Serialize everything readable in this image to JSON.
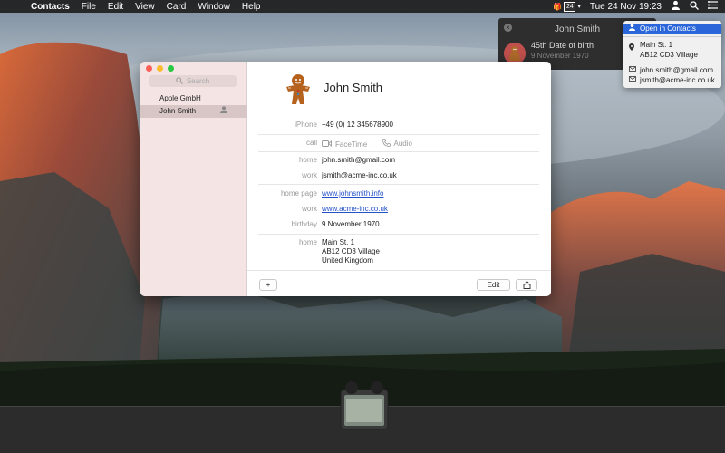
{
  "menubar": {
    "app_name": "Contacts",
    "menus": [
      "File",
      "Edit",
      "View",
      "Card",
      "Window",
      "Help"
    ],
    "calendar_icon_text": "24",
    "clock": "Tue 24 Nov  19:23"
  },
  "birthday_popup": {
    "name": "John Smith",
    "title": "45th Date of birth",
    "date": "9 November 1970"
  },
  "dropdown": {
    "open_label": "Open in Contacts",
    "address_line1": "Main St. 1",
    "address_line2": "AB12 CD3 Village",
    "email1": "john.smith@gmail.com",
    "email2": "jsmith@acme-inc.co.uk"
  },
  "sidebar": {
    "search_placeholder": "Search",
    "items": [
      "Apple GmbH",
      "John Smith"
    ],
    "selected_index": 1
  },
  "card": {
    "name": "John Smith",
    "phone_label": "iPhone",
    "phone": "+49 (0) 12 345678900",
    "call_label": "call",
    "facetime_label": "FaceTime",
    "audio_label": "Audio",
    "email_home_label": "home",
    "email_home": "john.smith@gmail.com",
    "email_work_label": "work",
    "email_work": "jsmith@acme-inc.co.uk",
    "homepage_label": "home page",
    "homepage": "www.johnsmith.info",
    "url_work_label": "work",
    "url_work": "www.acme-inc.co.uk",
    "birthday_label": "birthday",
    "birthday": "9 November 1970",
    "address_label": "home",
    "address_line1": "Main St. 1",
    "address_line2": "AB12 CD3 Village",
    "address_line3": "United Kingdom"
  },
  "buttons": {
    "add": "+",
    "edit": "Edit"
  },
  "colors": {
    "accent": "#2a66d9",
    "sidebar_bg": "#f4e5e4",
    "link": "#2452c9"
  }
}
